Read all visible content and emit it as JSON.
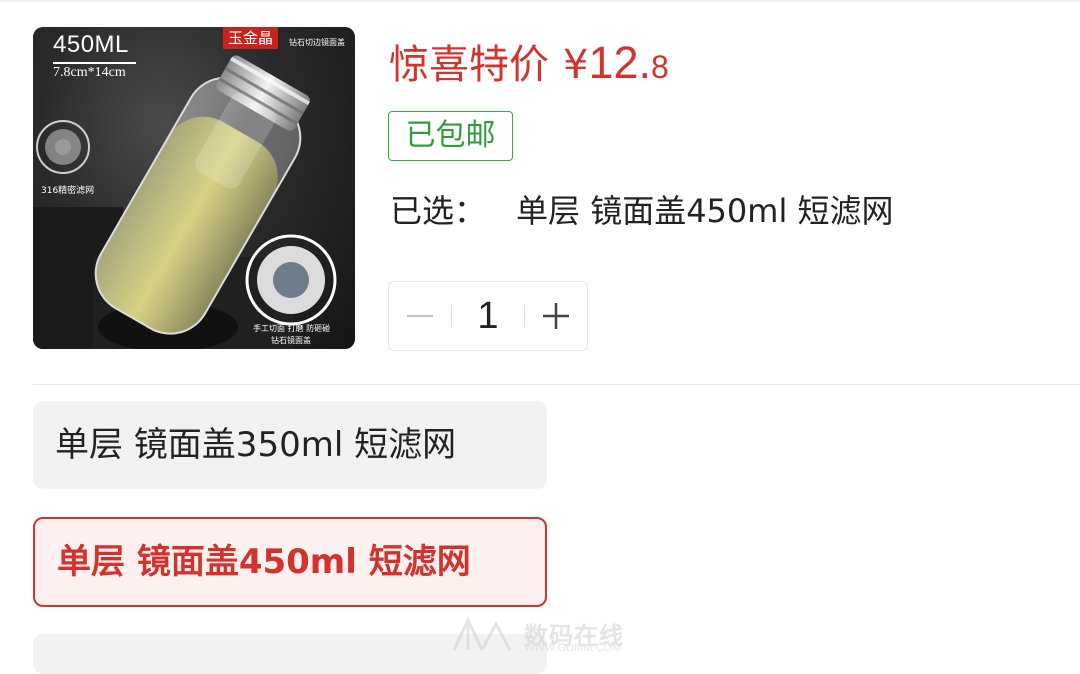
{
  "product_image": {
    "capacity": "450ML",
    "size": "7.8cm*14cm",
    "brand": "玉金晶",
    "lid_caption": "钻石切边镜面盖",
    "left_inset_caption": "316精密滤网",
    "right_inset_caption_1": "手工切面 打磨 防砸碰",
    "right_inset_caption_2": "钻石镜面盖"
  },
  "price": {
    "label": "惊喜特价",
    "currency": "¥",
    "integer": "12.",
    "decimal": "8"
  },
  "shipping_badge": "已包邮",
  "selected": {
    "label": "已选：",
    "value": "单层 镜面盖450ml 短滤网"
  },
  "quantity": {
    "value": "1",
    "decrement_icon": "minus-icon",
    "increment_icon": "plus-icon"
  },
  "options": [
    {
      "label": "单层 镜面盖350ml 短滤网",
      "selected": false
    },
    {
      "label": "单层 镜面盖450ml 短滤网",
      "selected": true
    },
    {
      "label": "",
      "selected": false
    }
  ],
  "watermark": {
    "text": "数码在线",
    "url": "WWW.GDMM.COM"
  },
  "colors": {
    "accent_red": "#d4322c",
    "shipping_green": "#3dab3d",
    "option_bg": "#f2f2f2",
    "selected_option_bg": "#fdf1f0"
  }
}
